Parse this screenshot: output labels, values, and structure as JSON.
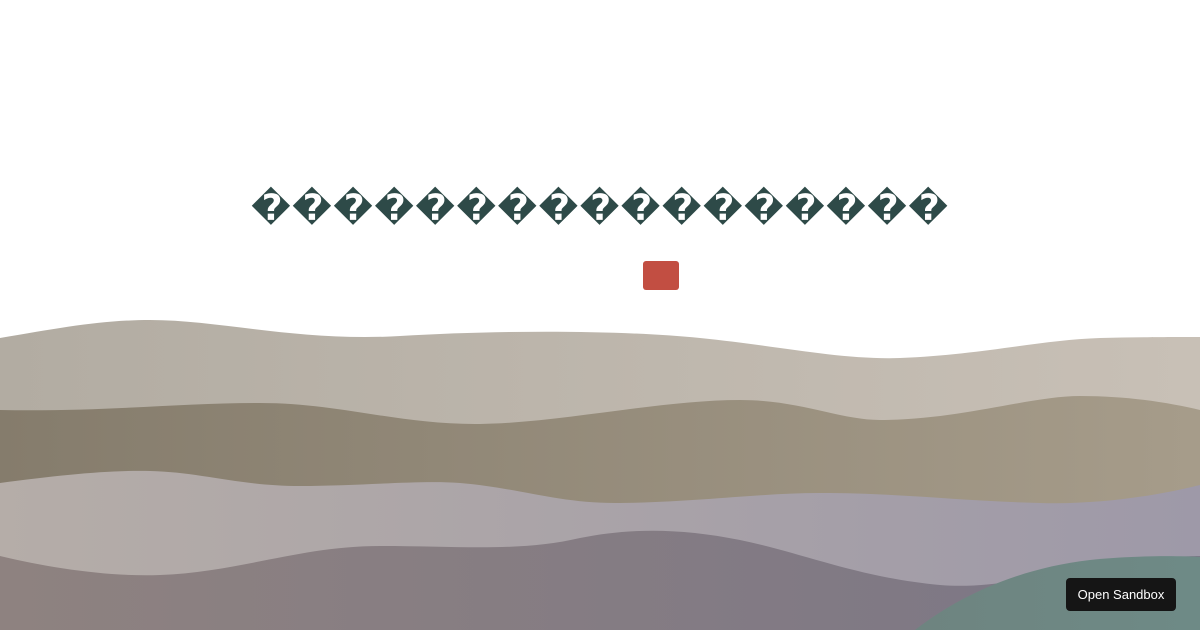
{
  "title": "�����������������",
  "accent_color": "#c24e42",
  "title_color": "#2e4a48",
  "open_sandbox_label": "Open Sandbox",
  "waves": [
    {
      "from": "#b2aca2",
      "to": "#c8c0b6"
    },
    {
      "from": "#857c6c",
      "to": "#a69c8a"
    },
    {
      "from": "#b5ada8",
      "to": "#9e99a8"
    },
    {
      "from": "#8e8280",
      "to": "#7b7686"
    },
    {
      "from": "#6e8480",
      "to": "#6e8a86"
    }
  ]
}
